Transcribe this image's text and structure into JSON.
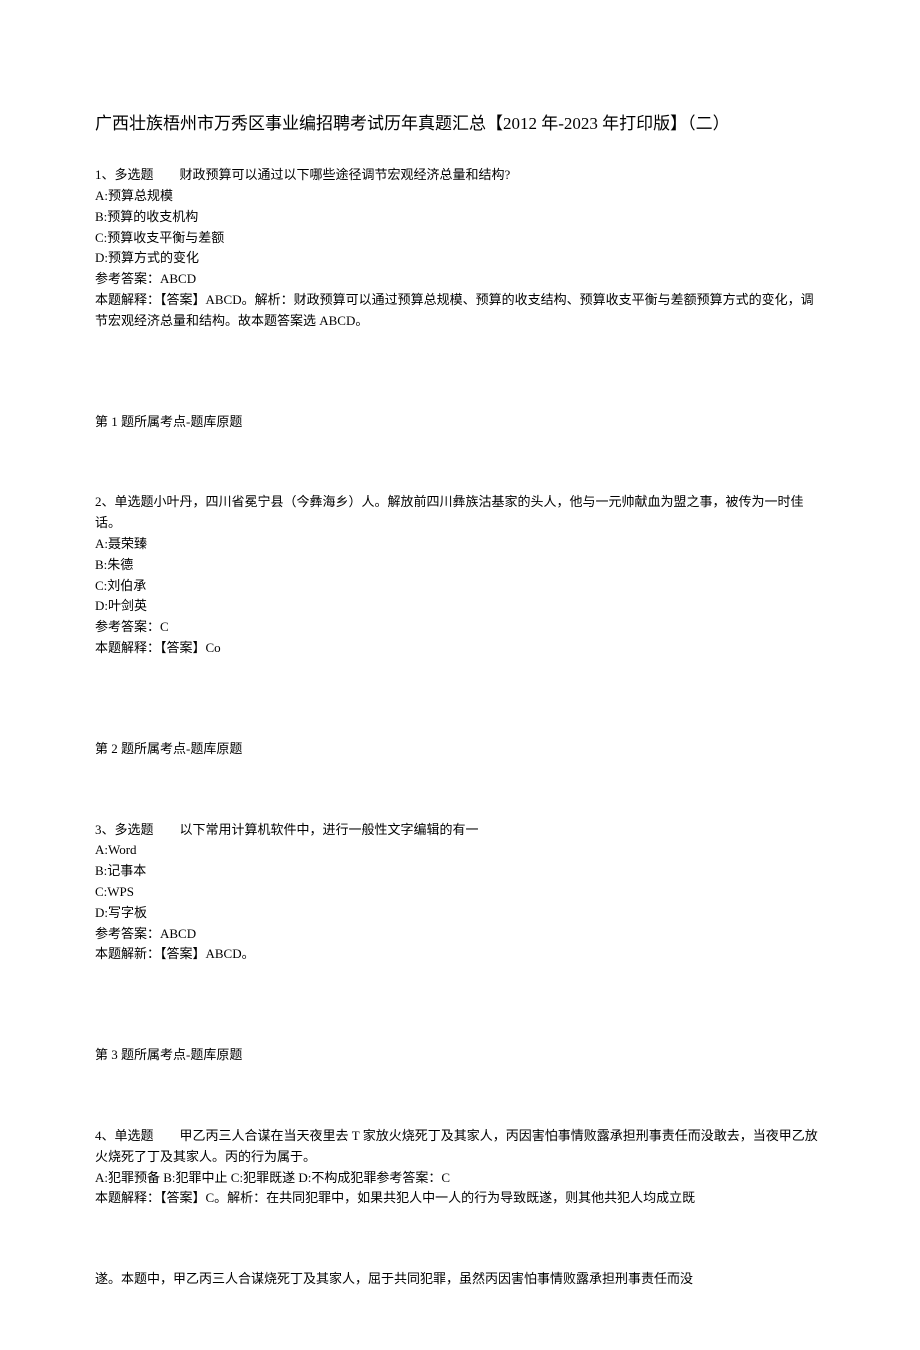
{
  "title": "广西壮族梧州市万秀区事业编招聘考试历年真题汇总【2012 年-2023 年打印版】（二）",
  "q1": {
    "header": "1、多选题　　财政预算可以通过以下哪些途径调节宏观经济总量和结构?",
    "optA": "A:预算总规模",
    "optB": "B:预算的收支机构",
    "optC": "C:预算收支平衡与差额",
    "optD": "D:预算方式的变化",
    "ans": "参考答案：ABCD",
    "expl": "本题解释：【答案】ABCD。解析：财政预算可以通过预算总规模、预算的收支结构、预算收支平衡与差额预算方式的变化，调节宏观经济总量和结构。故本题答案选 ABCD。",
    "point": "第 1 题所属考点-题库原题"
  },
  "q2": {
    "header": "2、单选题小叶丹，四川省冕宁县（今彝海乡）人。解放前四川彝族沽基家的头人，他与一元帅献血为盟之事，被传为一时佳话。",
    "optA": "A:聂荣臻",
    "optB": "B:朱德",
    "optC": "C:刘伯承",
    "optD": "D:叶剑英",
    "ans": "参考答案：C",
    "expl": "本题解释：【答案】Co",
    "point": "第 2 题所属考点-题库原题"
  },
  "q3": {
    "header": "3、多选题　　以下常用计算机软件中，进行一般性文字编辑的有一",
    "optA": "A:Word",
    "optB": "B:记事本",
    "optC": "C:WPS",
    "optD": "D:写字板",
    "ans": "参考答案：ABCD",
    "expl": "本题解新：【答案】ABCD。",
    "point": "第 3 题所属考点-题库原题"
  },
  "q4": {
    "header": "4、单选题　　甲乙丙三人合谋在当天夜里去 T 家放火烧死丁及其家人，丙因害怕事情败露承担刑事责任而没敢去，当夜甲乙放火烧死了丁及其家人。丙的行为属于。",
    "line2": "A:犯罪预备 B:犯罪中止 C:犯罪既遂 D:不构成犯罪参考答案：C",
    "expl": "本题解释：【答案】C。解析：在共同犯罪中，如果共犯人中一人的行为导致既遂，则其他共犯人均成立既",
    "cont": "遂。本题中，甲乙丙三人合谋烧死丁及其家人，屈于共同犯罪，虽然丙因害怕事情败露承担刑事责任而没"
  }
}
